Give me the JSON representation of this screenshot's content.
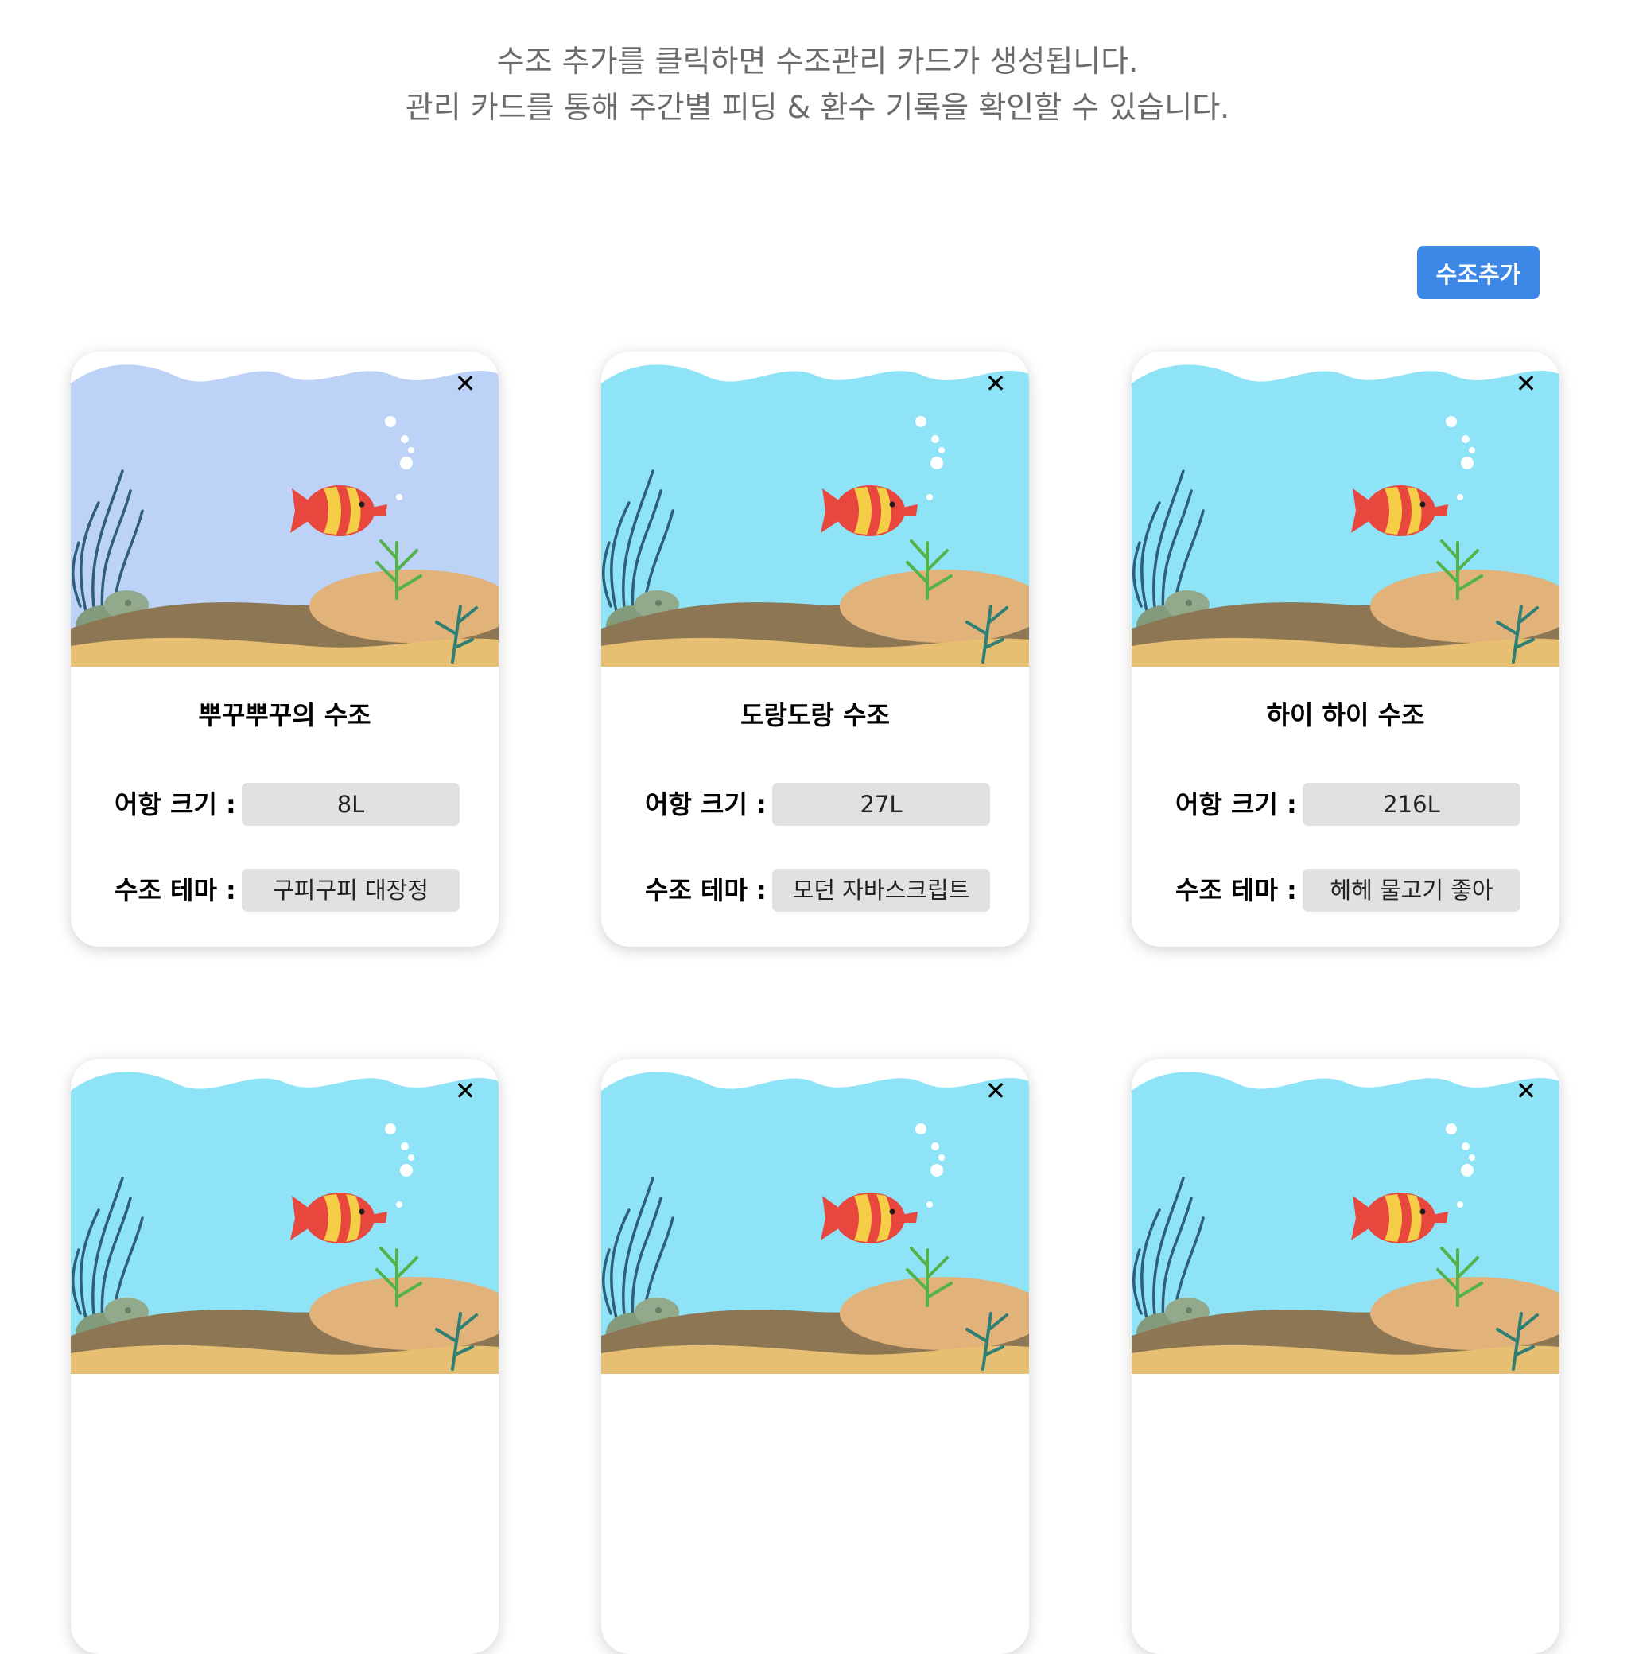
{
  "intro": {
    "line1": "수조 추가를 클릭하면 수조관리 카드가 생성됩니다.",
    "line2": "관리 카드를 통해 주간별 피딩 & 환수 기록을 확인할 수 있습니다."
  },
  "toolbar": {
    "add_label": "수조추가"
  },
  "labels": {
    "size": "어항 크기 :",
    "theme": "수조 테마 :"
  },
  "icons": {
    "close": "✕"
  },
  "colors": {
    "accent": "#3d87e6",
    "water_light": "#8ee5f7",
    "water_top": "#b7d2f8",
    "sand": "#e6bf72",
    "mud": "#8d7654",
    "fish_red": "#e8473e",
    "fish_yellow": "#f6cd47"
  },
  "cards": [
    {
      "title": "뿌꾸뿌꾸의 수조",
      "size": "8L",
      "theme": "구피구피 대장정"
    },
    {
      "title": "도랑도랑 수조",
      "size": "27L",
      "theme": "모던 자바스크립트"
    },
    {
      "title": "하이 하이 수조",
      "size": "216L",
      "theme": "헤헤 물고기 좋아"
    },
    {
      "title": "",
      "size": "",
      "theme": ""
    },
    {
      "title": "",
      "size": "",
      "theme": ""
    },
    {
      "title": "",
      "size": "",
      "theme": ""
    }
  ]
}
